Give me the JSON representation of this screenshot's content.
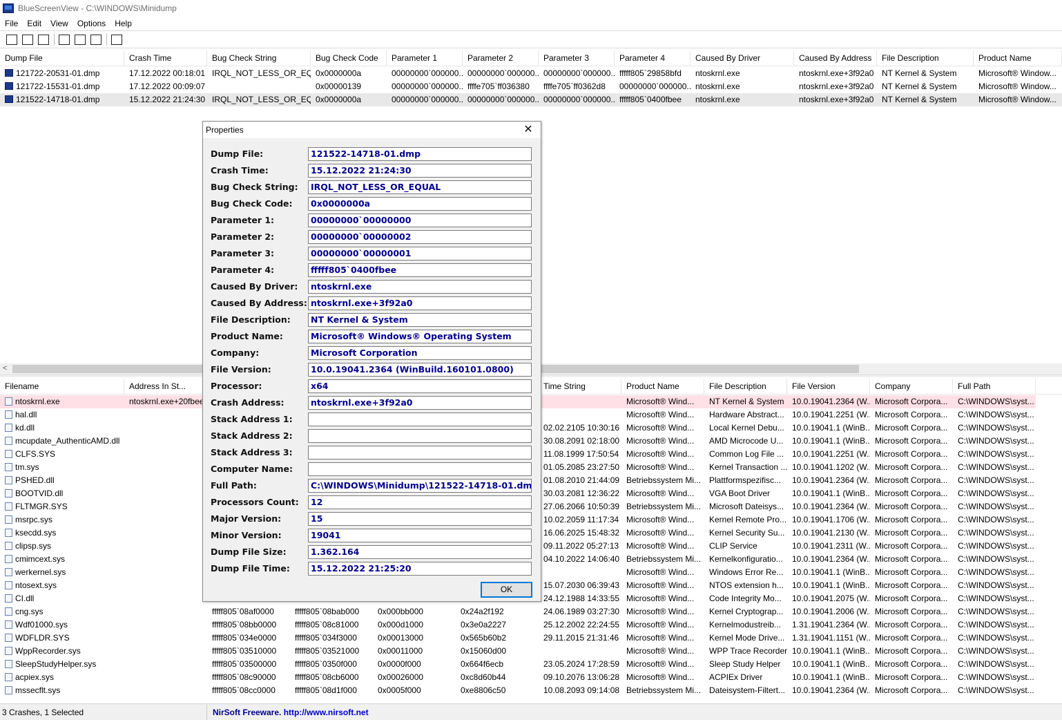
{
  "window": {
    "title": "BlueScreenView  -  C:\\WINDOWS\\Minidump"
  },
  "menu": [
    "File",
    "Edit",
    "View",
    "Options",
    "Help"
  ],
  "toolbar": {
    "buttons": [
      "html-report-icon",
      "save-icon",
      "refresh-icon",
      "copy-icon",
      "properties-icon",
      "find-icon",
      "exit-icon"
    ]
  },
  "upper": {
    "columns": [
      "Dump File",
      "Crash Time",
      "Bug Check String",
      "Bug Check Code",
      "Parameter 1",
      "Parameter 2",
      "Parameter 3",
      "Parameter 4",
      "Caused By Driver",
      "Caused By Address",
      "File Description",
      "Product Name"
    ],
    "rows": [
      [
        "121722-20531-01.dmp",
        "17.12.2022 00:18:01",
        "IRQL_NOT_LESS_OR_EQ...",
        "0x0000000a",
        "00000000`000000...",
        "00000000`000000...",
        "00000000`000000...",
        "fffff805`29858bfd",
        "ntoskrnl.exe",
        "ntoskrnl.exe+3f92a0",
        "NT Kernel & System",
        "Microsoft® Window..."
      ],
      [
        "121722-15531-01.dmp",
        "17.12.2022 00:09:07",
        "",
        "0x00000139",
        "00000000`000000...",
        "ffffe705`ff036380",
        "ffffe705`ff0362d8",
        "00000000`000000...",
        "ntoskrnl.exe",
        "ntoskrnl.exe+3f92a0",
        "NT Kernel & System",
        "Microsoft® Window..."
      ],
      [
        "121522-14718-01.dmp",
        "15.12.2022 21:24:30",
        "IRQL_NOT_LESS_OR_EQ...",
        "0x0000000a",
        "00000000`000000...",
        "00000000`000000...",
        "00000000`000000...",
        "fffff805`0400fbee",
        "ntoskrnl.exe",
        "ntoskrnl.exe+3f92a0",
        "NT Kernel & System",
        "Microsoft® Window..."
      ]
    ],
    "selected_row": 2
  },
  "lower": {
    "columns": [
      "Filename",
      "Address In St...",
      "",
      "",
      "",
      "",
      "Time String",
      "Product Name",
      "File Description",
      "File Version",
      "Company",
      "Full Path"
    ],
    "rows": [
      [
        "ntoskrnl.exe",
        "ntoskrnl.exe+20fbee",
        "",
        "",
        "",
        "",
        "",
        "Microsoft® Wind...",
        "NT Kernel & System",
        "10.0.19041.2364 (W...",
        "Microsoft Corpora...",
        "C:\\WINDOWS\\syst..."
      ],
      [
        "hal.dll",
        "",
        "",
        "",
        "",
        "",
        "",
        "Microsoft® Wind...",
        "Hardware Abstract...",
        "10.0.19041.2251 (W...",
        "Microsoft Corpora...",
        "C:\\WINDOWS\\syst..."
      ],
      [
        "kd.dll",
        "",
        "",
        "",
        "",
        "",
        "02.02.2105 10:30:16",
        "Microsoft® Wind...",
        "Local Kernel Debu...",
        "10.0.19041.1 (WinB...",
        "Microsoft Corpora...",
        "C:\\WINDOWS\\syst..."
      ],
      [
        "mcupdate_AuthenticAMD.dll",
        "",
        "",
        "",
        "",
        "",
        "30.08.2091 02:18:00",
        "Microsoft® Wind...",
        "AMD Microcode U...",
        "10.0.19041.1 (WinB...",
        "Microsoft Corpora...",
        "C:\\WINDOWS\\syst..."
      ],
      [
        "CLFS.SYS",
        "",
        "",
        "",
        "",
        "",
        "11.08.1999 17:50:54",
        "Microsoft® Wind...",
        "Common Log File ...",
        "10.0.19041.2251 (W...",
        "Microsoft Corpora...",
        "C:\\WINDOWS\\syst..."
      ],
      [
        "tm.sys",
        "",
        "",
        "",
        "",
        "",
        "01.05.2085 23:27:50",
        "Microsoft® Wind...",
        "Kernel Transaction ...",
        "10.0.19041.1202 (W...",
        "Microsoft Corpora...",
        "C:\\WINDOWS\\syst..."
      ],
      [
        "PSHED.dll",
        "",
        "",
        "",
        "",
        "",
        "01.08.2010 21:44:09",
        "Betriebssystem Mi...",
        "Plattformspezifisc...",
        "10.0.19041.2364 (W...",
        "Microsoft Corpora...",
        "C:\\WINDOWS\\syst..."
      ],
      [
        "BOOTVID.dll",
        "",
        "",
        "",
        "",
        "",
        "30.03.2081 12:36:22",
        "Microsoft® Wind...",
        "VGA Boot Driver",
        "10.0.19041.1 (WinB...",
        "Microsoft Corpora...",
        "C:\\WINDOWS\\syst..."
      ],
      [
        "FLTMGR.SYS",
        "",
        "",
        "",
        "",
        "",
        "27.06.2066 10:50:39",
        "Betriebssystem Mi...",
        "Microsoft Dateisys...",
        "10.0.19041.2364 (W...",
        "Microsoft Corpora...",
        "C:\\WINDOWS\\syst..."
      ],
      [
        "msrpc.sys",
        "",
        "",
        "",
        "",
        "",
        "10.02.2059 11:17:34",
        "Microsoft® Wind...",
        "Kernel Remote Pro...",
        "10.0.19041.1706 (W...",
        "Microsoft Corpora...",
        "C:\\WINDOWS\\syst..."
      ],
      [
        "ksecdd.sys",
        "",
        "",
        "",
        "",
        "",
        "16.06.2025 15:48:32",
        "Microsoft® Wind...",
        "Kernel Security Su...",
        "10.0.19041.2130 (W...",
        "Microsoft Corpora...",
        "C:\\WINDOWS\\syst..."
      ],
      [
        "clipsp.sys",
        "",
        "",
        "",
        "",
        "",
        "09.11.2022 05:27:13",
        "Microsoft® Wind...",
        "CLIP Service",
        "10.0.19041.2311 (W...",
        "Microsoft Corpora...",
        "C:\\WINDOWS\\syst..."
      ],
      [
        "cmimcext.sys",
        "",
        "",
        "",
        "",
        "",
        "04.10.2022 14:06:40",
        "Betriebssystem Mi...",
        "Kernelkonfiguratio...",
        "10.0.19041.2364 (W...",
        "Microsoft Corpora...",
        "C:\\WINDOWS\\syst..."
      ],
      [
        "werkernel.sys",
        "",
        "",
        "",
        "",
        "",
        "",
        "Microsoft® Wind...",
        "Windows Error Re...",
        "10.0.19041.1 (WinB...",
        "Microsoft Corpora...",
        "C:\\WINDOWS\\syst..."
      ],
      [
        "ntosext.sys",
        "",
        "",
        "",
        "",
        "",
        "15.07.2030 06:39:43",
        "Microsoft® Wind...",
        "NTOS extension h...",
        "10.0.19041.1 (WinB...",
        "Microsoft Corpora...",
        "C:\\WINDOWS\\syst..."
      ],
      [
        "CI.dll",
        "",
        "",
        "",
        "",
        "",
        "24.12.1988 14:33:55",
        "Microsoft® Wind...",
        "Code Integrity Mo...",
        "10.0.19041.2075 (W...",
        "Microsoft Corpora...",
        "C:\\WINDOWS\\syst..."
      ],
      [
        "cng.sys",
        "",
        "fffff805`08af0000",
        "fffff805`08bab000",
        "0x000bb000",
        "0x24a2f192",
        "24.06.1989 03:27:30",
        "Microsoft® Wind...",
        "Kernel Cryptograp...",
        "10.0.19041.2006 (W...",
        "Microsoft Corpora...",
        "C:\\WINDOWS\\syst..."
      ],
      [
        "Wdf01000.sys",
        "",
        "fffff805`08bb0000",
        "fffff805`08c81000",
        "0x000d1000",
        "0x3e0a2227",
        "25.12.2002 22:24:55",
        "Microsoft® Wind...",
        "Kernelmodustreib...",
        "1.31.19041.2364 (W...",
        "Microsoft Corpora...",
        "C:\\WINDOWS\\syst..."
      ],
      [
        "WDFLDR.SYS",
        "",
        "fffff805`034e0000",
        "fffff805`034f3000",
        "0x00013000",
        "0x565b60b2",
        "29.11.2015 21:31:46",
        "Microsoft® Wind...",
        "Kernel Mode Drive...",
        "1.31.19041.1151 (W...",
        "Microsoft Corpora...",
        "C:\\WINDOWS\\syst..."
      ],
      [
        "WppRecorder.sys",
        "",
        "fffff805`03510000",
        "fffff805`03521000",
        "0x00011000",
        "0x15060d00",
        "",
        "Microsoft® Wind...",
        "WPP Trace Recorder",
        "10.0.19041.1 (WinB...",
        "Microsoft Corpora...",
        "C:\\WINDOWS\\syst..."
      ],
      [
        "SleepStudyHelper.sys",
        "",
        "fffff805`03500000",
        "fffff805`0350f000",
        "0x0000f000",
        "0x664f6ecb",
        "23.05.2024 17:28:59",
        "Microsoft® Wind...",
        "Sleep Study Helper",
        "10.0.19041.1 (WinB...",
        "Microsoft Corpora...",
        "C:\\WINDOWS\\syst..."
      ],
      [
        "acpiex.sys",
        "",
        "fffff805`08c90000",
        "fffff805`08cb6000",
        "0x00026000",
        "0xc8d60b44",
        "09.10.2076 13:06:28",
        "Microsoft® Wind...",
        "ACPIEx Driver",
        "10.0.19041.1 (WinB...",
        "Microsoft Corpora...",
        "C:\\WINDOWS\\syst..."
      ],
      [
        "mssecflt.sys",
        "",
        "fffff805`08cc0000",
        "fffff805`08d1f000",
        "0x0005f000",
        "0xe8806c50",
        "10.08.2093 09:14:08",
        "Betriebssystem Mi...",
        "Dateisystem-Filtert...",
        "10.0.19041.2364 (W...",
        "Microsoft Corpora...",
        "C:\\WINDOWS\\syst..."
      ]
    ]
  },
  "dialog": {
    "title": "Properties",
    "ok_label": "OK",
    "fields": [
      {
        "label": "Dump File:",
        "value": "121522-14718-01.dmp"
      },
      {
        "label": "Crash Time:",
        "value": "15.12.2022 21:24:30"
      },
      {
        "label": "Bug Check String:",
        "value": "IRQL_NOT_LESS_OR_EQUAL"
      },
      {
        "label": "Bug Check Code:",
        "value": "0x0000000a"
      },
      {
        "label": "Parameter 1:",
        "value": "00000000`00000000"
      },
      {
        "label": "Parameter 2:",
        "value": "00000000`00000002"
      },
      {
        "label": "Parameter 3:",
        "value": "00000000`00000001"
      },
      {
        "label": "Parameter 4:",
        "value": "fffff805`0400fbee"
      },
      {
        "label": "Caused By Driver:",
        "value": "ntoskrnl.exe"
      },
      {
        "label": "Caused By Address:",
        "value": "ntoskrnl.exe+3f92a0"
      },
      {
        "label": "File Description:",
        "value": "NT Kernel & System"
      },
      {
        "label": "Product Name:",
        "value": "Microsoft® Windows® Operating System"
      },
      {
        "label": "Company:",
        "value": "Microsoft Corporation"
      },
      {
        "label": "File Version:",
        "value": "10.0.19041.2364 (WinBuild.160101.0800)"
      },
      {
        "label": "Processor:",
        "value": "x64"
      },
      {
        "label": "Crash Address:",
        "value": "ntoskrnl.exe+3f92a0"
      },
      {
        "label": "Stack Address 1:",
        "value": ""
      },
      {
        "label": "Stack Address 2:",
        "value": ""
      },
      {
        "label": "Stack Address 3:",
        "value": ""
      },
      {
        "label": "Computer Name:",
        "value": ""
      },
      {
        "label": "Full Path:",
        "value": "C:\\WINDOWS\\Minidump\\121522-14718-01.dmp"
      },
      {
        "label": "Processors Count:",
        "value": "12"
      },
      {
        "label": "Major Version:",
        "value": "15"
      },
      {
        "label": "Minor Version:",
        "value": "19041"
      },
      {
        "label": "Dump File Size:",
        "value": "1.362.164"
      },
      {
        "label": "Dump File Time:",
        "value": "15.12.2022 21:25:20"
      }
    ]
  },
  "status": {
    "left": "3 Crashes, 1 Selected",
    "link_label": "NirSoft Freeware.  ",
    "link_url": "http://www.nirsoft.net"
  },
  "colors": {
    "dialog_value": "#00008b",
    "selected_row": "#e8e8e8",
    "highlight_row": "#ffe0e6"
  }
}
